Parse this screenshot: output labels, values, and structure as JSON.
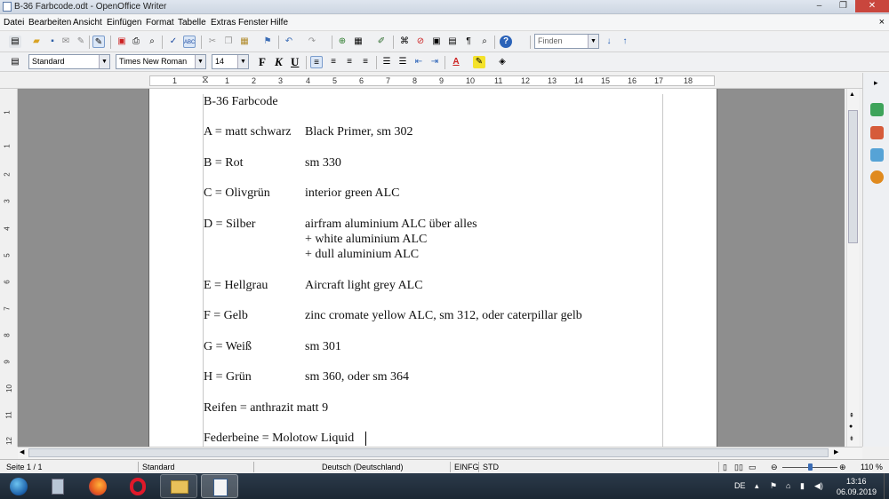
{
  "window": {
    "title": "B-36 Farbcode.odt - OpenOffice Writer",
    "minimize_icon": "minimize-icon",
    "maximize_icon": "maximize-icon",
    "close_icon": "close-icon",
    "close_color": "#c9463d"
  },
  "menu": {
    "items": [
      "Datei",
      "Bearbeiten",
      "Ansicht",
      "Einfügen",
      "Format",
      "Tabelle",
      "Extras",
      "Fenster",
      "Hilfe"
    ],
    "close_glyph": "×"
  },
  "toolbar": {
    "find_placeholder": "Finden",
    "paragraph_style": "Standard",
    "font_name": "Times New Roman",
    "font_size": "14",
    "bold": "F",
    "italic": "K",
    "underline": "U"
  },
  "ruler": {
    "numbers": [
      "1",
      "1",
      "2",
      "3",
      "4",
      "5",
      "6",
      "7",
      "8",
      "9",
      "10",
      "11",
      "12",
      "13",
      "14",
      "15",
      "16",
      "17",
      "18"
    ],
    "v_numbers": [
      "1",
      "1",
      "2",
      "3",
      "4",
      "5",
      "6",
      "7",
      "8",
      "9",
      "10",
      "11",
      "12"
    ]
  },
  "document": {
    "title": "B-36 Farbcode",
    "rows": [
      {
        "key": "A = matt schwarz",
        "value": "Black Primer, sm 302"
      },
      {
        "key": "B = Rot",
        "value": "sm 330"
      },
      {
        "key": "C = Olivgrün",
        "value": "interior green ALC"
      },
      {
        "key": "D = Silber",
        "value": "airfram aluminium ALC über alles",
        "extra": [
          "+ white aluminium ALC",
          "+ dull aluminium ALC"
        ]
      },
      {
        "key": "E = Hellgrau",
        "value": "Aircraft light grey ALC"
      },
      {
        "key": "F = Gelb",
        "value": "zinc cromate yellow ALC, sm 312, oder caterpillar gelb"
      },
      {
        "key": "G = Weiß",
        "value": "sm 301"
      },
      {
        "key": "H = Grün",
        "value": "sm 360, oder sm 364"
      }
    ],
    "tires": "Reifen = anthrazit matt 9",
    "struts": "Federbeine = Molotow Liquid"
  },
  "status": {
    "page": "Seite 1 / 1",
    "style": "Standard",
    "language": "Deutsch (Deutschland)",
    "insert_mode": "EINFG",
    "selection_mode": "STD",
    "zoom": "110 %"
  },
  "taskbar": {
    "lang": "DE",
    "time": "13:16",
    "date": "06.09.2019",
    "apps": [
      "start-button",
      "calculator-app",
      "firefox-app",
      "opera-app",
      "explorer-app",
      "writer-app"
    ]
  }
}
